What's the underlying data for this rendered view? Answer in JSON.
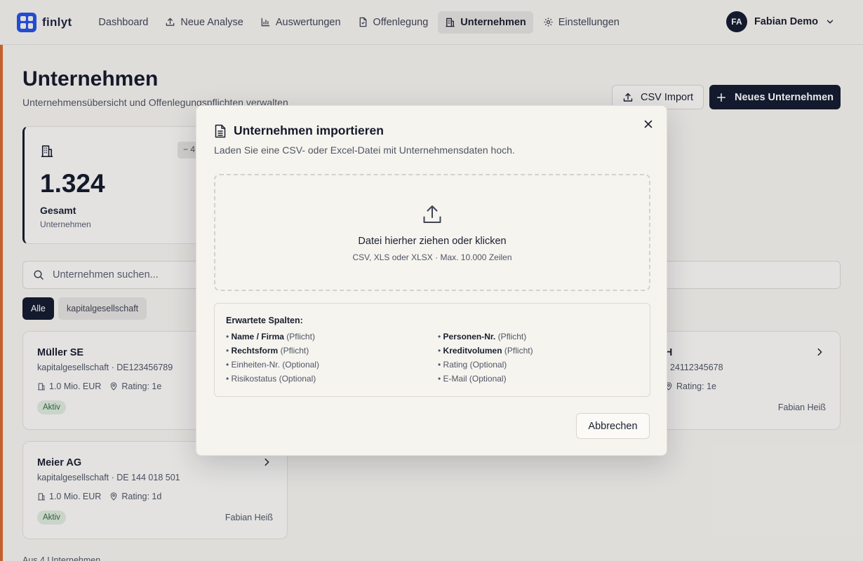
{
  "app": {
    "logo_text": "finlyt"
  },
  "nav": {
    "items": [
      {
        "label": "Dashboard",
        "icon": "none"
      },
      {
        "label": "Neue Analyse",
        "icon": "upload-icon"
      },
      {
        "label": "Auswertungen",
        "icon": "bar-chart-icon"
      },
      {
        "label": "Offenlegung",
        "icon": "document-icon"
      },
      {
        "label": "Unternehmen",
        "icon": "building-icon",
        "active": true
      },
      {
        "label": "Einstellungen",
        "icon": "gear-icon"
      }
    ]
  },
  "user": {
    "initials": "FA",
    "name": "Fabian Demo"
  },
  "page": {
    "title": "Unternehmen",
    "subtitle": "Unternehmensübersicht und Offenlegungspflichten verwalten",
    "csv_import_label": "CSV Import",
    "new_company_label": "Neues Unternehmen"
  },
  "stats": {
    "chip": "− 4",
    "value": "1.324",
    "label": "Gesamt",
    "sublabel": "Unternehmen"
  },
  "search": {
    "placeholder": "Unternehmen suchen..."
  },
  "filters": {
    "all": "Alle",
    "kapital": "kapitalgesellschaft"
  },
  "companies": [
    {
      "name": "Müller SE",
      "meta": "kapitalgesellschaft · DE123456789",
      "volume": "1.0 Mio. EUR",
      "rating": "Rating: 1e",
      "status": "Aktiv",
      "owner": ""
    },
    {
      "name": "bH",
      "meta": "24112345678",
      "volume": "",
      "rating": "Rating: 1e",
      "status": "",
      "owner": "Fabian Heiß"
    },
    {
      "name": "Meier AG",
      "meta": "kapitalgesellschaft · DE 144 018 501",
      "volume": "1.0 Mio. EUR",
      "rating": "Rating: 1d",
      "status": "Aktiv",
      "owner": "Fabian Heiß"
    }
  ],
  "footer": {
    "count": "Aus 4 Unternehmen"
  },
  "modal": {
    "title": "Unternehmen importieren",
    "description": "Laden Sie eine CSV- oder Excel-Datei mit Unternehmensdaten hoch.",
    "dropzone_title": "Datei hierher ziehen oder klicken",
    "dropzone_sub": "CSV, XLS oder XLSX · Max. 10.000 Zeilen",
    "columns_title": "Erwartete Spalten:",
    "columns_left": [
      {
        "name": "Name / Firma",
        "req": "(Pflicht)",
        "bold": true
      },
      {
        "name": "Rechtsform",
        "req": "(Pflicht)",
        "bold": true
      },
      {
        "name": "Einheiten-Nr.",
        "req": "(Optional)",
        "bold": false
      },
      {
        "name": "Risikostatus",
        "req": "(Optional)",
        "bold": false
      }
    ],
    "columns_right": [
      {
        "name": "Personen-Nr.",
        "req": "(Pflicht)",
        "bold": true
      },
      {
        "name": "Kreditvolumen",
        "req": "(Pflicht)",
        "bold": true
      },
      {
        "name": "Rating",
        "req": "(Optional)",
        "bold": false
      },
      {
        "name": "E-Mail",
        "req": "(Optional)",
        "bold": false
      }
    ],
    "cancel_label": "Abbrechen"
  }
}
